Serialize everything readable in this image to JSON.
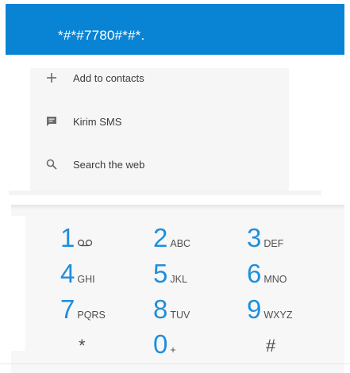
{
  "dialer": {
    "number": "*#*#7780#*#*."
  },
  "suggestions": [
    {
      "label": "Add to contacts",
      "icon": "plus-icon"
    },
    {
      "label": "Kirim SMS",
      "icon": "message-icon"
    },
    {
      "label": "Search the web",
      "icon": "search-icon"
    }
  ],
  "keypad": {
    "keys": [
      {
        "digit": "1",
        "letters": "",
        "icon": "voicemail-icon"
      },
      {
        "digit": "2",
        "letters": "ABC"
      },
      {
        "digit": "3",
        "letters": "DEF"
      },
      {
        "digit": "4",
        "letters": "GHI"
      },
      {
        "digit": "5",
        "letters": "JKL"
      },
      {
        "digit": "6",
        "letters": "MNO"
      },
      {
        "digit": "7",
        "letters": "PQRS"
      },
      {
        "digit": "8",
        "letters": "TUV"
      },
      {
        "digit": "9",
        "letters": "WXYZ"
      },
      {
        "digit": "*",
        "letters": ""
      },
      {
        "digit": "0",
        "letters": "+"
      },
      {
        "digit": "#",
        "letters": ""
      }
    ]
  },
  "colors": {
    "accent": "#0984d4",
    "digit": "#1f8fdc"
  }
}
